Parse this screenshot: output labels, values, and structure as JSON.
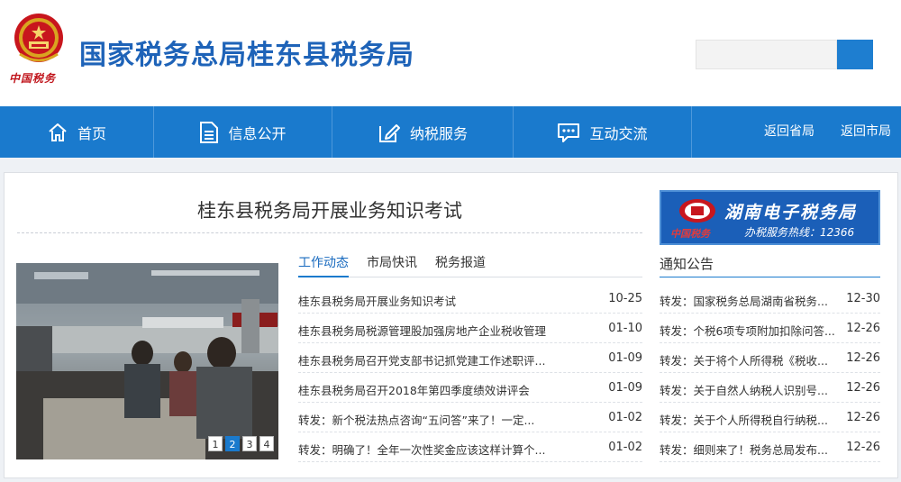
{
  "header": {
    "title": "国家税务总局桂东县税务局",
    "slogan": "中国税务",
    "search_placeholder": ""
  },
  "nav": {
    "items": [
      {
        "label": "首页",
        "icon": "home-icon"
      },
      {
        "label": "信息公开",
        "icon": "document-icon"
      },
      {
        "label": "纳税服务",
        "icon": "edit-icon"
      },
      {
        "label": "互动交流",
        "icon": "chat-icon"
      }
    ],
    "links": [
      "返回省局",
      "返回市局"
    ]
  },
  "headline": "桂东县税务局开展业务知识考试",
  "slideshow": {
    "pages": [
      "1",
      "2",
      "3",
      "4"
    ],
    "active_page": 2
  },
  "news": {
    "tabs": [
      "工作动态",
      "市局快讯",
      "税务报道"
    ],
    "items": [
      {
        "title": "桂东县税务局开展业务知识考试",
        "date": "10-25"
      },
      {
        "title": "桂东县税务局税源管理股加强房地产企业税收管理",
        "date": "01-10"
      },
      {
        "title": "桂东县税务局召开党支部书记抓党建工作述职评...",
        "date": "01-09"
      },
      {
        "title": "桂东县税务局召开2018年第四季度绩效讲评会",
        "date": "01-09"
      },
      {
        "title": "转发：新个税法热点咨询“五问答”来了！一定...",
        "date": "01-02"
      },
      {
        "title": "转发：明确了！全年一次性奖金应该这样计算个...",
        "date": "01-02"
      }
    ]
  },
  "banner": {
    "title": "湖南电子税务局",
    "subtitle": "办税服务热线：12366",
    "slogan": "中国税务"
  },
  "notices": {
    "title": "通知公告",
    "items": [
      {
        "title": "转发：国家税务总局湖南省税务...",
        "date": "12-30"
      },
      {
        "title": "转发：个税6项专项附加扣除问答...",
        "date": "12-26"
      },
      {
        "title": "转发：关于将个人所得税《税收...",
        "date": "12-26"
      },
      {
        "title": "转发：关于自然人纳税人识别号...",
        "date": "12-26"
      },
      {
        "title": "转发：关于个人所得税自行纳税...",
        "date": "12-26"
      },
      {
        "title": "转发：细则来了！税务总局发布...",
        "date": "12-26"
      }
    ]
  },
  "colors": {
    "brand_blue": "#1a7acd",
    "title_blue": "#1e63b8",
    "slogan_red": "#c0141b"
  }
}
